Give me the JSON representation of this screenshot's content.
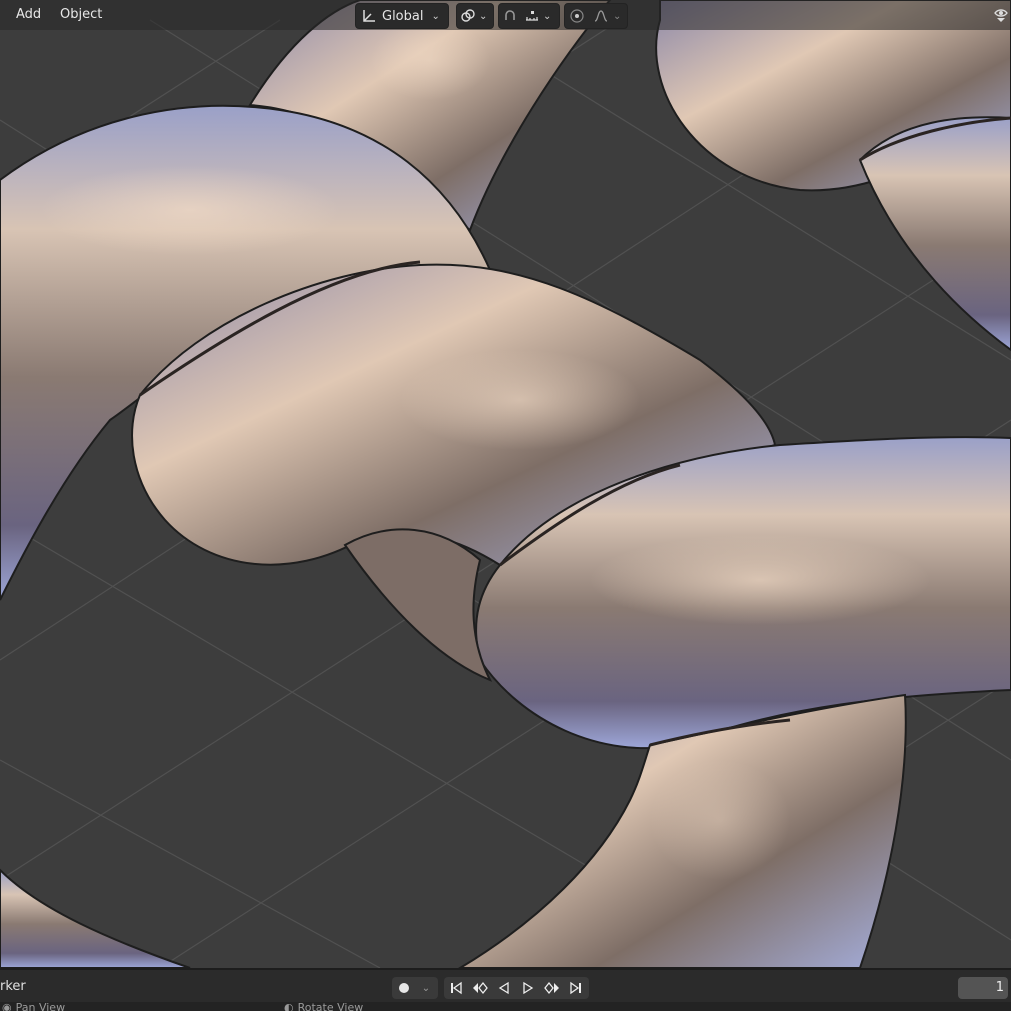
{
  "header": {
    "menu": {
      "add": "Add",
      "object": "Object"
    },
    "transform_orientation": "Global"
  },
  "timeline": {
    "marker_label": "rker",
    "current_frame": "1"
  },
  "status_bar": {
    "item1": "Pan View",
    "item2": "Rotate View"
  },
  "colors": {
    "viewport_bg": "#3d3d3d",
    "grid_line": "#555555",
    "header_bg": "#282828",
    "timeline_bg": "#2b2b2b",
    "accent": "#4772b3"
  },
  "icons": [
    "transform-orientation-icon",
    "pivot-icon",
    "snap-icon",
    "snap-increment-icon",
    "proportional-edit-icon",
    "falloff-icon",
    "overlay-eye-icon",
    "record-icon",
    "jump-start-icon",
    "prev-keyframe-icon",
    "play-reverse-icon",
    "play-icon",
    "next-keyframe-icon",
    "jump-end-icon"
  ]
}
